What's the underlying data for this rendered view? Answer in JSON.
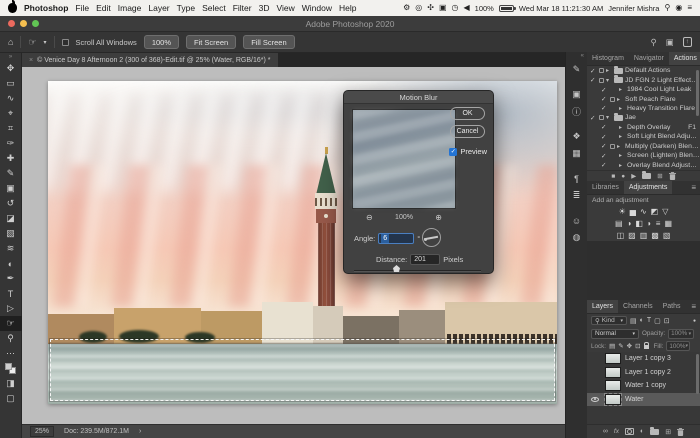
{
  "menubar": {
    "menus": [
      "Photoshop",
      "File",
      "Edit",
      "Image",
      "Layer",
      "Type",
      "Select",
      "Filter",
      "3D",
      "View",
      "Window",
      "Help"
    ],
    "extras": [
      {
        "name": "menu-extra-1",
        "glyph": "⚙"
      },
      {
        "name": "menu-extra-2",
        "glyph": "◎"
      },
      {
        "name": "menu-extra-3",
        "glyph": "✣"
      },
      {
        "name": "menu-extra-4",
        "glyph": "▣"
      },
      {
        "name": "menu-extra-5",
        "glyph": "◷"
      },
      {
        "name": "volume",
        "glyph": "◀"
      }
    ],
    "battery_percent": "100%",
    "datetime": "Wed Mar 18  11:21:30 AM",
    "user_name": "Jennifer Mishra",
    "spotlight_glyph": "⚲",
    "siri_glyph": "◉",
    "notification_glyph": "≡"
  },
  "window": {
    "title": "Adobe Photoshop 2020"
  },
  "options_bar": {
    "home_glyph": "⌂",
    "tool_glyph": "☞",
    "caret": "▾",
    "scroll_all_windows_label": "Scroll All Windows",
    "zoom_100_label": "100%",
    "fit_screen_label": "Fit Screen",
    "fill_screen_label": "Fill Screen",
    "search_glyph": "⚲",
    "workspace_glyph": "▣",
    "share_glyph": "↑"
  },
  "document_tab": {
    "close_glyph": "×",
    "title": "© Venice Day 8 Afternoon 2 (300 of 368)-Edit.tif @ 25% (Water, RGB/16*) *"
  },
  "toolbar": {
    "header_glyph": "»",
    "tools": [
      {
        "name": "move",
        "glyph": "✥"
      },
      {
        "name": "rectangular-marquee",
        "glyph": "▭"
      },
      {
        "name": "lasso",
        "glyph": "∿"
      },
      {
        "name": "object-selection",
        "glyph": "⌖"
      },
      {
        "name": "crop",
        "glyph": "⌗"
      },
      {
        "name": "eyedropper",
        "glyph": "✑"
      },
      {
        "name": "spot-healing-brush",
        "glyph": "✚"
      },
      {
        "name": "brush",
        "glyph": "✎"
      },
      {
        "name": "clone-stamp",
        "glyph": "▣"
      },
      {
        "name": "history-brush",
        "glyph": "↺"
      },
      {
        "name": "eraser",
        "glyph": "◪"
      },
      {
        "name": "gradient",
        "glyph": "▧"
      },
      {
        "name": "blur",
        "glyph": "≋"
      },
      {
        "name": "dodge",
        "glyph": "◐"
      },
      {
        "name": "pen",
        "glyph": "✒"
      },
      {
        "name": "type",
        "glyph": "T"
      },
      {
        "name": "path-selection",
        "glyph": "▷"
      },
      {
        "name": "hand",
        "glyph": "☞"
      },
      {
        "name": "zoom",
        "glyph": "⚲"
      },
      {
        "name": "edit-toolbar",
        "glyph": "⋯"
      },
      {
        "name": "quick-mask",
        "glyph": "◨"
      },
      {
        "name": "screen-mode",
        "glyph": "▢"
      }
    ]
  },
  "dialog": {
    "title": "Motion Blur",
    "ok": "OK",
    "cancel": "Cancel",
    "preview": "Preview",
    "zoom_out_glyph": "⊖",
    "zoom_in_glyph": "⊕",
    "zoom_level": "100%",
    "angle_label": "Angle:",
    "angle_value": "6",
    "angle_degree": "°",
    "distance_label": "Distance:",
    "distance_value": "201",
    "distance_unit": "Pixels"
  },
  "glyphs": {
    "check": "✓",
    "closed": "▸",
    "open": "▾",
    "menu": "≡",
    "collapse": "«",
    "stop": "■",
    "record": "●",
    "play": "▶",
    "new": "⊞",
    "link": "∞",
    "fx": "fx",
    "adjustment": "◐",
    "dot": "●",
    "arrow": "›",
    "search": "⚲",
    "caret": "▾",
    "image_filter": "▤",
    "type_filter": "T",
    "shape_filter": "▢",
    "smart_filter": "⊡"
  },
  "panels_strip": {
    "icons": [
      {
        "name": "brush-settings",
        "glyph": "✎"
      },
      {
        "name": "clone-source",
        "glyph": "▣"
      },
      {
        "name": "info",
        "glyph": "ⓘ"
      },
      {
        "name": "swatches",
        "glyph": "❖"
      },
      {
        "name": "character-styles",
        "glyph": "▦"
      },
      {
        "name": "paragraph-styles",
        "glyph": "¶"
      },
      {
        "name": "tool-presets",
        "glyph": "≣"
      },
      {
        "name": "character",
        "glyph": "☺"
      },
      {
        "name": "3d",
        "glyph": "◍"
      }
    ]
  },
  "panels": {
    "group1": {
      "tabs": [
        "Histogram",
        "Navigator",
        "Actions"
      ]
    },
    "actions": {
      "items": [
        {
          "name": "Default Actions"
        },
        {
          "name": "JD FGN 2 Light Effects S..."
        },
        {
          "name": "1984 Cool Light Leak"
        },
        {
          "name": "Soft Peach Flare"
        },
        {
          "name": "Heavy Transition Flare"
        },
        {
          "name": "Jae"
        },
        {
          "name": "Depth Overlay",
          "shortcut": "F1"
        },
        {
          "name": "Soft Light Blend Adjustme..."
        },
        {
          "name": "Multiply (Darken) Blend A..."
        },
        {
          "name": "Screen (Lighten) Blend Ad..."
        },
        {
          "name": "Overlay Blend Adjustment..."
        }
      ]
    },
    "group2": {
      "tabs": [
        "Libraries",
        "Adjustments"
      ],
      "hint": "Add an adjustment"
    },
    "adjustments_icons": [
      {
        "name": "brightness-contrast",
        "glyph": "☀"
      },
      {
        "name": "levels",
        "glyph": "▅"
      },
      {
        "name": "curves",
        "glyph": "∿"
      },
      {
        "name": "exposure",
        "glyph": "◩"
      },
      {
        "name": "vibrance",
        "glyph": "▽"
      },
      {
        "name": "hue-saturation",
        "glyph": "▤"
      },
      {
        "name": "color-balance",
        "glyph": "◑"
      },
      {
        "name": "black-white",
        "glyph": "◧"
      },
      {
        "name": "photo-filter",
        "glyph": "◗"
      },
      {
        "name": "channel-mixer",
        "glyph": "≡"
      },
      {
        "name": "color-lookup",
        "glyph": "▦"
      },
      {
        "name": "invert",
        "glyph": "◫"
      },
      {
        "name": "posterize",
        "glyph": "▨"
      },
      {
        "name": "threshold",
        "glyph": "▥"
      },
      {
        "name": "selective-color",
        "glyph": "▩"
      },
      {
        "name": "gradient-map",
        "glyph": "▧"
      }
    ],
    "group3": {
      "tabs": [
        "Layers",
        "Channels",
        "Paths"
      ]
    },
    "layers": {
      "filter_kind": "Kind",
      "blend_mode": "Normal",
      "opacity_label": "Opacity:",
      "opacity_value": "100%",
      "lock_label": "Lock:",
      "fill_label": "Fill:",
      "fill_value": "100%",
      "items": [
        {
          "name": "Layer 1 copy 3"
        },
        {
          "name": "Layer 1 copy 2"
        },
        {
          "name": "Water 1 copy"
        },
        {
          "name": "Water"
        }
      ]
    }
  },
  "status_bar": {
    "zoom": "25%",
    "doc_info": "Doc: 239.5M/872.1M",
    "arrow": "›"
  },
  "colors": {
    "accent_blue": "#2374d4",
    "traffic_red": "#ec6a5e",
    "traffic_yellow": "#f5bf4f",
    "traffic_green": "#61c554"
  }
}
